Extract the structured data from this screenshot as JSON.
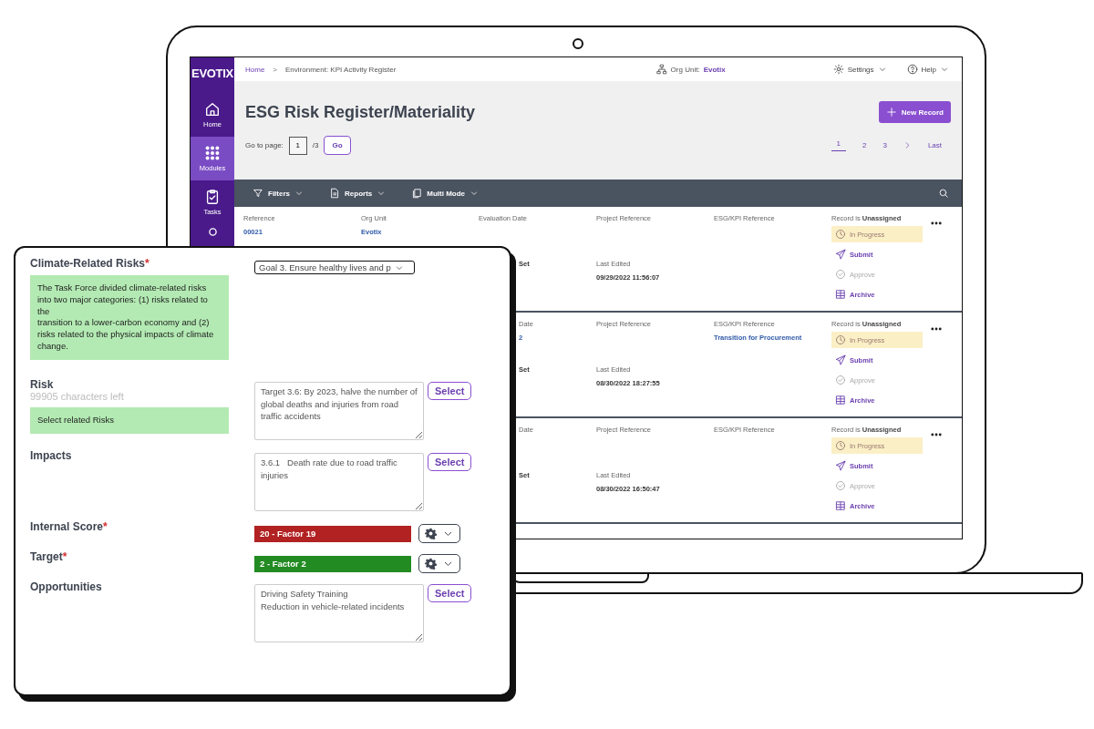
{
  "app": {
    "logo": "EVOTIX",
    "sidebar": {
      "items": [
        {
          "label": "Home",
          "selected": false
        },
        {
          "label": "Modules",
          "selected": true
        },
        {
          "label": "Tasks",
          "selected": false
        },
        {
          "selected": false
        }
      ]
    },
    "breadcrumb": {
      "items": [
        "Home",
        "Environment: KPI Activity Register"
      ],
      "separator": ">"
    },
    "org_unit": {
      "label": "Org Unit:",
      "value": "Evotix"
    },
    "top_menus": [
      {
        "label": "Settings"
      },
      {
        "label": "Help"
      }
    ],
    "title": "ESG Risk Register/Materiality",
    "new_record_button": "New Record",
    "go_to_page": {
      "label": "Go to page:",
      "value": "1",
      "total": "/3",
      "button": "Go"
    },
    "pagination": {
      "pages": [
        {
          "label": "1",
          "selected": true
        },
        {
          "label": "2",
          "selected": false
        },
        {
          "label": "3",
          "selected": false
        }
      ],
      "last": "Last"
    },
    "toolbar": [
      {
        "label": "Filters"
      },
      {
        "label": "Reports"
      },
      {
        "label": "Multi Mode"
      }
    ],
    "records": [
      {
        "top": {
          "reference": {
            "label": "Reference",
            "value": "00021"
          },
          "org_unit": {
            "label": "Org Unit",
            "value": "Evotix"
          },
          "evaluation_date": {
            "label": "Evaluation Date"
          },
          "project_reference": {
            "label": "Project Reference"
          },
          "esg_kpi_reference": {
            "label": "ESG/KPI Reference"
          }
        },
        "bottom": {
          "evaluation_date": {
            "value": "Set"
          },
          "project_reference": {
            "label": "Last Edited",
            "value": "09/29/2022 11:56:07"
          }
        },
        "assignment": "Record is **Unassigned**",
        "status": "In Progress",
        "actions": [
          {
            "label": "Submit",
            "disabled": false
          },
          {
            "label": "Approve",
            "disabled": true
          },
          {
            "label": "Archive",
            "disabled": false
          }
        ]
      },
      {
        "top": {
          "evaluation_date": {
            "label": "Date",
            "value": "2"
          },
          "project_reference": {
            "label": "Project Reference"
          },
          "esg_kpi_reference": {
            "label": "ESG/KPI Reference",
            "value": "Transition for Procurement"
          }
        },
        "bottom": {
          "evaluation_date": {
            "value": "Set"
          },
          "project_reference": {
            "label": "Last Edited",
            "value": "08/30/2022 18:27:55"
          }
        },
        "assignment": "Record is **Unassigned**",
        "status": "In Progress",
        "actions": [
          {
            "label": "Submit",
            "disabled": false
          },
          {
            "label": "Approve",
            "disabled": true
          },
          {
            "label": "Archive",
            "disabled": false
          }
        ]
      },
      {
        "top": {
          "evaluation_date": {
            "label": "Date"
          },
          "project_reference": {
            "label": "Project Reference"
          },
          "esg_kpi_reference": {
            "label": "ESG/KPI Reference"
          }
        },
        "bottom": {
          "evaluation_date": {
            "value": "Set"
          },
          "project_reference": {
            "label": "Last Edited",
            "value": "08/30/2022 16:50:47"
          }
        },
        "assignment": "Record is **Unassigned**",
        "status": "In Progress",
        "actions": [
          {
            "label": "Submit",
            "disabled": false
          },
          {
            "label": "Approve",
            "disabled": true
          },
          {
            "label": "Archive",
            "disabled": false
          }
        ]
      }
    ]
  },
  "form": {
    "fields": [
      {
        "label": "Climate-Related Risks",
        "marker": "*",
        "kind": "select",
        "help": "The Task Force divided climate-related risks into two major categories: (1) risks related to the\ntransition to a lower-carbon economy and (2) risks related to the physical impacts of climate\nchange.",
        "value": "Goal 3. Ensure healthy lives and p"
      },
      {
        "label": "Risk",
        "hint": "99905 characters left",
        "help": "Select related Risks",
        "kind": "textarea",
        "value": "Target 3.6: By 2023, halve the number of global deaths and injuries from road traffic accidents",
        "button": "Select"
      },
      {
        "label": "Impacts",
        "kind": "textarea",
        "value": "3.6.1   Death rate due to road traffic injuries",
        "button": "Select"
      },
      {
        "label": "Internal Score",
        "marker": "*",
        "kind": "score",
        "value": "20 - Factor 19",
        "color": "#b22222"
      },
      {
        "label": "Target",
        "marker": "*",
        "kind": "score",
        "value": "2 - Factor 2",
        "color": "#228b22"
      },
      {
        "label": "Opportunities",
        "kind": "textarea",
        "value": "Driving Safety Training\nReduction in vehicle-related incidents",
        "button": "Select"
      }
    ]
  }
}
